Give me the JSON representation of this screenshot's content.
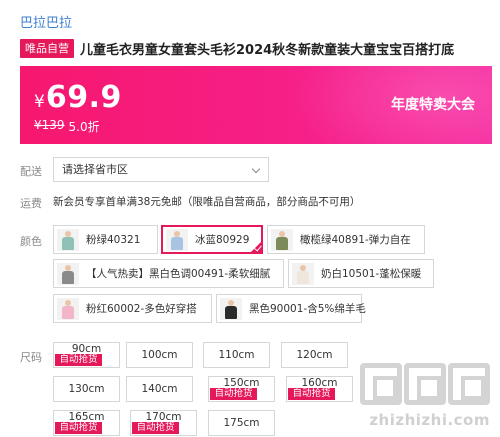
{
  "store": {
    "name": "巴拉巴拉"
  },
  "product": {
    "badge": "唯品自营",
    "title": "儿童毛衣男童女童套头毛衫2024秋冬新款童装大童宝宝百搭打底"
  },
  "price": {
    "currency": "¥",
    "value": "69.9",
    "original": "¥139",
    "discount": "5.0折",
    "promo": "年度特卖大会"
  },
  "delivery": {
    "label": "配送",
    "select_value": "请选择省市区"
  },
  "shipping": {
    "label": "运费",
    "text": "新会员专享首单满38元免邮（限唯品自营商品，部分商品不可用）"
  },
  "colors": {
    "label": "颜色",
    "options": [
      {
        "name": "粉绿40321",
        "swatch": "#8fc1b6",
        "selected": false
      },
      {
        "name": "冰蓝80929",
        "swatch": "#a9c4e2",
        "selected": true
      },
      {
        "name": "橄榄绿40891-弹力自在",
        "swatch": "#7d8a5a",
        "selected": false
      },
      {
        "name": "【人气热卖】黑白色调00491-柔软细腻",
        "swatch": "#8a8a8a",
        "selected": false
      },
      {
        "name": "奶白10501-蓬松保暖",
        "swatch": "#efe7dc",
        "selected": false
      },
      {
        "name": "粉红60002-多色好穿搭",
        "swatch": "#f2b6c8",
        "selected": false
      },
      {
        "name": "黑色90001-含5%绵羊毛",
        "swatch": "#2a2a2a",
        "selected": false
      }
    ]
  },
  "sizes": {
    "label": "尺码",
    "options": [
      {
        "name": "90cm",
        "tag": "自动抢货"
      },
      {
        "name": "100cm",
        "tag": ""
      },
      {
        "name": "110cm",
        "tag": ""
      },
      {
        "name": "120cm",
        "tag": ""
      },
      {
        "name": "130cm",
        "tag": ""
      },
      {
        "name": "140cm",
        "tag": ""
      },
      {
        "name": "150cm",
        "tag": "自动抢货"
      },
      {
        "name": "160cm",
        "tag": "自动抢货"
      },
      {
        "name": "165cm",
        "tag": "自动抢货"
      },
      {
        "name": "170cm",
        "tag": "自动抢货"
      },
      {
        "name": "175cm",
        "tag": ""
      }
    ]
  },
  "watermark": {
    "text": "zhizhizhi.com"
  },
  "colors_theme": {
    "accent": "#e5185a",
    "link": "#3d7fd1"
  }
}
